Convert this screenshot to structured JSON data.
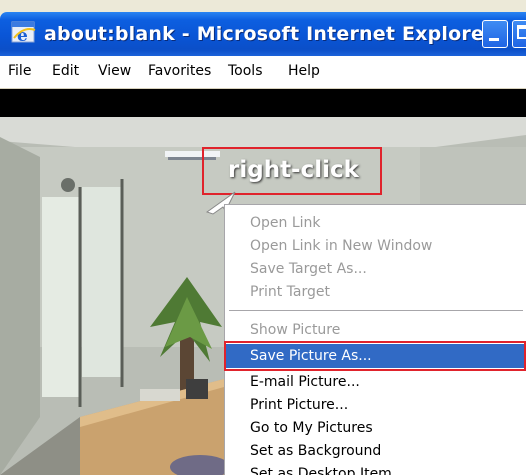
{
  "window": {
    "title": "about:blank - Microsoft Internet Explorer",
    "colors": {
      "titlebar": "#0b57d0",
      "highlight": "#316ac5",
      "callout": "#e0232c"
    }
  },
  "menubar": {
    "items": [
      {
        "label": "File"
      },
      {
        "label": "Edit"
      },
      {
        "label": "View"
      },
      {
        "label": "Favorites"
      },
      {
        "label": "Tools"
      },
      {
        "label": "Help"
      }
    ]
  },
  "annotation": {
    "label": "right-click"
  },
  "context_menu": {
    "items": [
      {
        "label": "Open Link",
        "state": "disabled"
      },
      {
        "label": "Open Link in New Window",
        "state": "disabled"
      },
      {
        "label": "Save Target As...",
        "state": "disabled"
      },
      {
        "label": "Print Target",
        "state": "disabled"
      },
      {
        "label": "Show Picture",
        "state": "disabled"
      },
      {
        "label": "Save Picture As...",
        "state": "highlighted"
      },
      {
        "label": "E-mail Picture...",
        "state": "enabled"
      },
      {
        "label": "Print Picture...",
        "state": "enabled"
      },
      {
        "label": "Go to My Pictures",
        "state": "enabled"
      },
      {
        "label": "Set as Background",
        "state": "enabled"
      },
      {
        "label": "Set as Desktop Item...",
        "state": "enabled"
      }
    ]
  }
}
